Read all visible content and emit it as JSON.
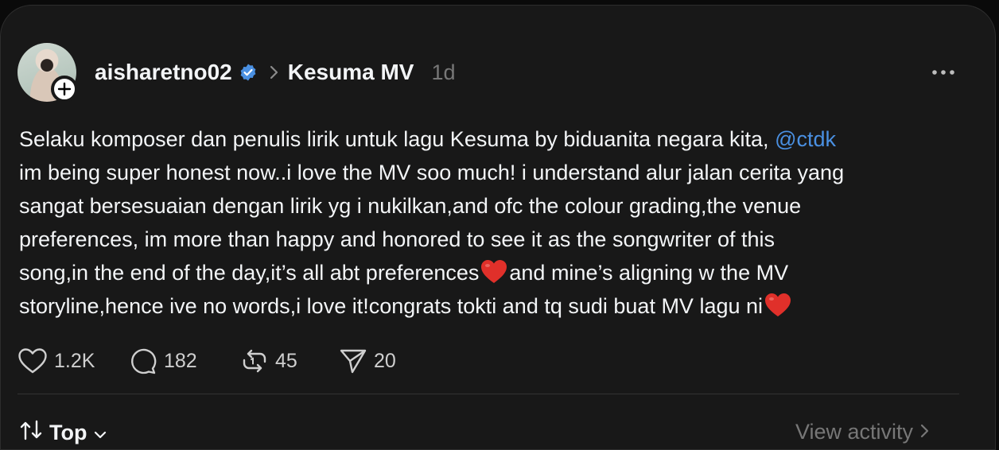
{
  "post": {
    "username": "aisharetno02",
    "topic": "Kesuma MV",
    "time": "1d",
    "body": {
      "line1": "Selaku komposer dan penulis lirik untuk lagu Kesuma by biduanita negara kita,",
      "mention": "@ctdk",
      "line2": "im being super honest now..i love the MV soo much! i understand alur jalan cerita yang",
      "line3": "sangat bersesuaian dengan lirik yg i nukilkan,and ofc the colour grading,the venue",
      "line4": "preferences, im more than happy and honored to see it as the songwriter of this",
      "line5a": "song,in the end of the day,it’s all abt preferences",
      "line5b": "and mine’s aligning w the MV",
      "line6": "storyline,hence ive no words,i love it!congrats tokti and tq sudi buat MV lagu ni"
    }
  },
  "actions": {
    "likes": "1.2K",
    "replies": "182",
    "reposts": "45",
    "shares": "20"
  },
  "footer": {
    "sort_label": "Top",
    "view_activity": "View activity"
  },
  "icons": {
    "verified": "verified-badge-icon",
    "chevron": "chevron-right-icon",
    "more": "more-dots-icon",
    "like": "heart-icon",
    "reply": "comment-icon",
    "repost": "repost-icon",
    "share": "send-icon",
    "emoji": "red-heart-emoji"
  },
  "colors": {
    "background": "#181818",
    "mention": "#4a90e2",
    "verified": "#4a90e2",
    "heart_emoji": "#e0302a"
  }
}
